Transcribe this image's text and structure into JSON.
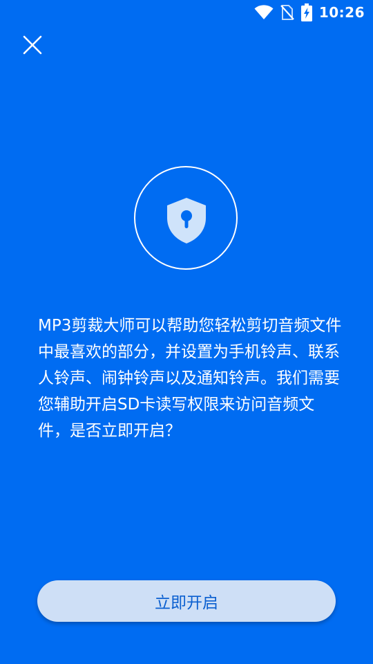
{
  "status_bar": {
    "time": "10:26",
    "icons": [
      "wifi-icon",
      "no-sim-icon",
      "battery-charging-icon"
    ]
  },
  "close": {
    "icon": "close-icon"
  },
  "hero": {
    "icon": "shield-keyhole-icon"
  },
  "description": "MP3剪裁大师可以帮助您轻松剪切音频文件中最喜欢的部分，并设置为手机铃声、联系人铃声、闹钟铃声以及通知铃声。我们需要您辅助开启SD卡读写权限来访问音频文件，是否立即开启？",
  "action": {
    "enable_label": "立即开启"
  },
  "colors": {
    "background": "#006CF2",
    "button_bg": "#CEDFF6",
    "button_text": "#0A5FD0",
    "shield_fill": "#CFE3FA"
  }
}
